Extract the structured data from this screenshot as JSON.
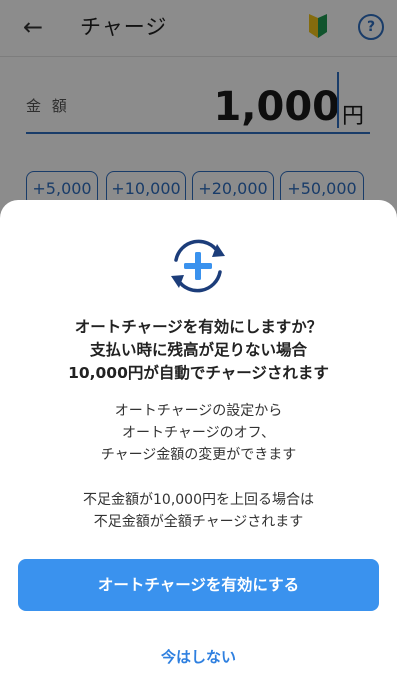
{
  "header": {
    "title": "チャージ",
    "back_icon": "back-arrow-icon",
    "beginner_icon": "beginner-mark-icon",
    "help_label": "?"
  },
  "amount": {
    "label": "金 額",
    "value": "1,000",
    "unit": "円"
  },
  "quick_amounts": [
    "+5,000",
    "+10,000",
    "+20,000",
    "+50,000"
  ],
  "modal": {
    "icon": "auto-charge-refresh-plus-icon",
    "title_lines": [
      "オートチャージを有効にしますか？",
      "支払い時に残高が足りない場合",
      "10,000円が自動でチャージされます"
    ],
    "desc_lines": [
      "オートチャージの設定から",
      "オートチャージのオフ、",
      "チャージ金額の変更ができます"
    ],
    "note_lines": [
      "不足金額が10,000円を上回る場合は",
      "不足金額が全額チャージされます"
    ],
    "primary_label": "オートチャージを有効にする",
    "secondary_label": "今はしない"
  },
  "colors": {
    "accent": "#3a92ee",
    "link": "#2f80e0",
    "brand_blue": "#2f6ebf"
  }
}
